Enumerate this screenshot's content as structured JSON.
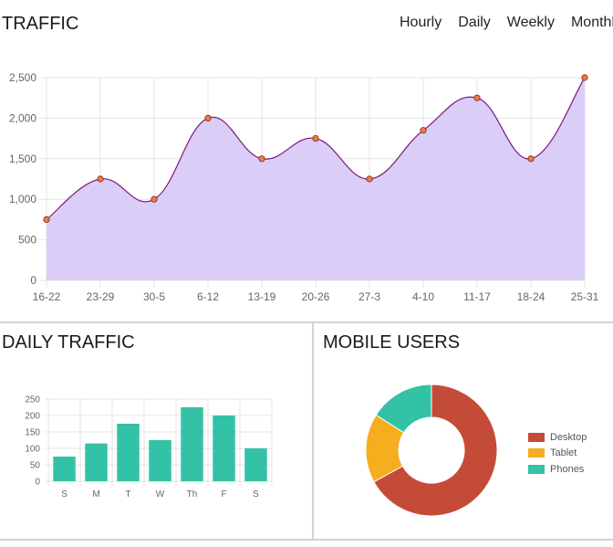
{
  "header": {
    "title": "TRAFFIC",
    "tabs": [
      {
        "label": "Hourly"
      },
      {
        "label": "Daily"
      },
      {
        "label": "Weekly"
      },
      {
        "label": "Monthly"
      }
    ]
  },
  "daily_section": {
    "title": "DAILY TRAFFIC"
  },
  "mobile_section": {
    "title": "MOBILE USERS"
  },
  "colors": {
    "line": "#7a1b7a",
    "area": "#dacdf8",
    "points": "#f07a3c",
    "bars": "#33c2a6",
    "desktop": "#c54b39",
    "tablet": "#f6ad1e",
    "phones": "#33c2a6",
    "divider": "#d9cfd6"
  },
  "chart_data": [
    {
      "type": "area",
      "categories": [
        "16-22",
        "23-29",
        "30-5",
        "6-12",
        "13-19",
        "20-26",
        "27-3",
        "4-10",
        "11-17",
        "18-24",
        "25-31"
      ],
      "values": [
        750,
        1250,
        1000,
        2000,
        1500,
        1750,
        1250,
        1850,
        2250,
        1500,
        2500
      ],
      "yticks": [
        "0",
        "500",
        "1,000",
        "1,500",
        "2,000",
        "2,500"
      ],
      "ylim": [
        0,
        2500
      ],
      "grid": true,
      "legend": "none"
    },
    {
      "type": "bar",
      "categories": [
        "S",
        "M",
        "T",
        "W",
        "Th",
        "F",
        "S"
      ],
      "values": [
        75,
        115,
        175,
        125,
        225,
        200,
        100
      ],
      "yticks": [
        "0",
        "50",
        "100",
        "150",
        "200",
        "250"
      ],
      "ylim": [
        0,
        250
      ],
      "grid": true,
      "legend": "none"
    },
    {
      "type": "pie",
      "donut": true,
      "labels": [
        "Desktop",
        "Tablet",
        "Phones"
      ],
      "values": [
        67,
        17,
        16
      ],
      "legend": "right"
    }
  ]
}
